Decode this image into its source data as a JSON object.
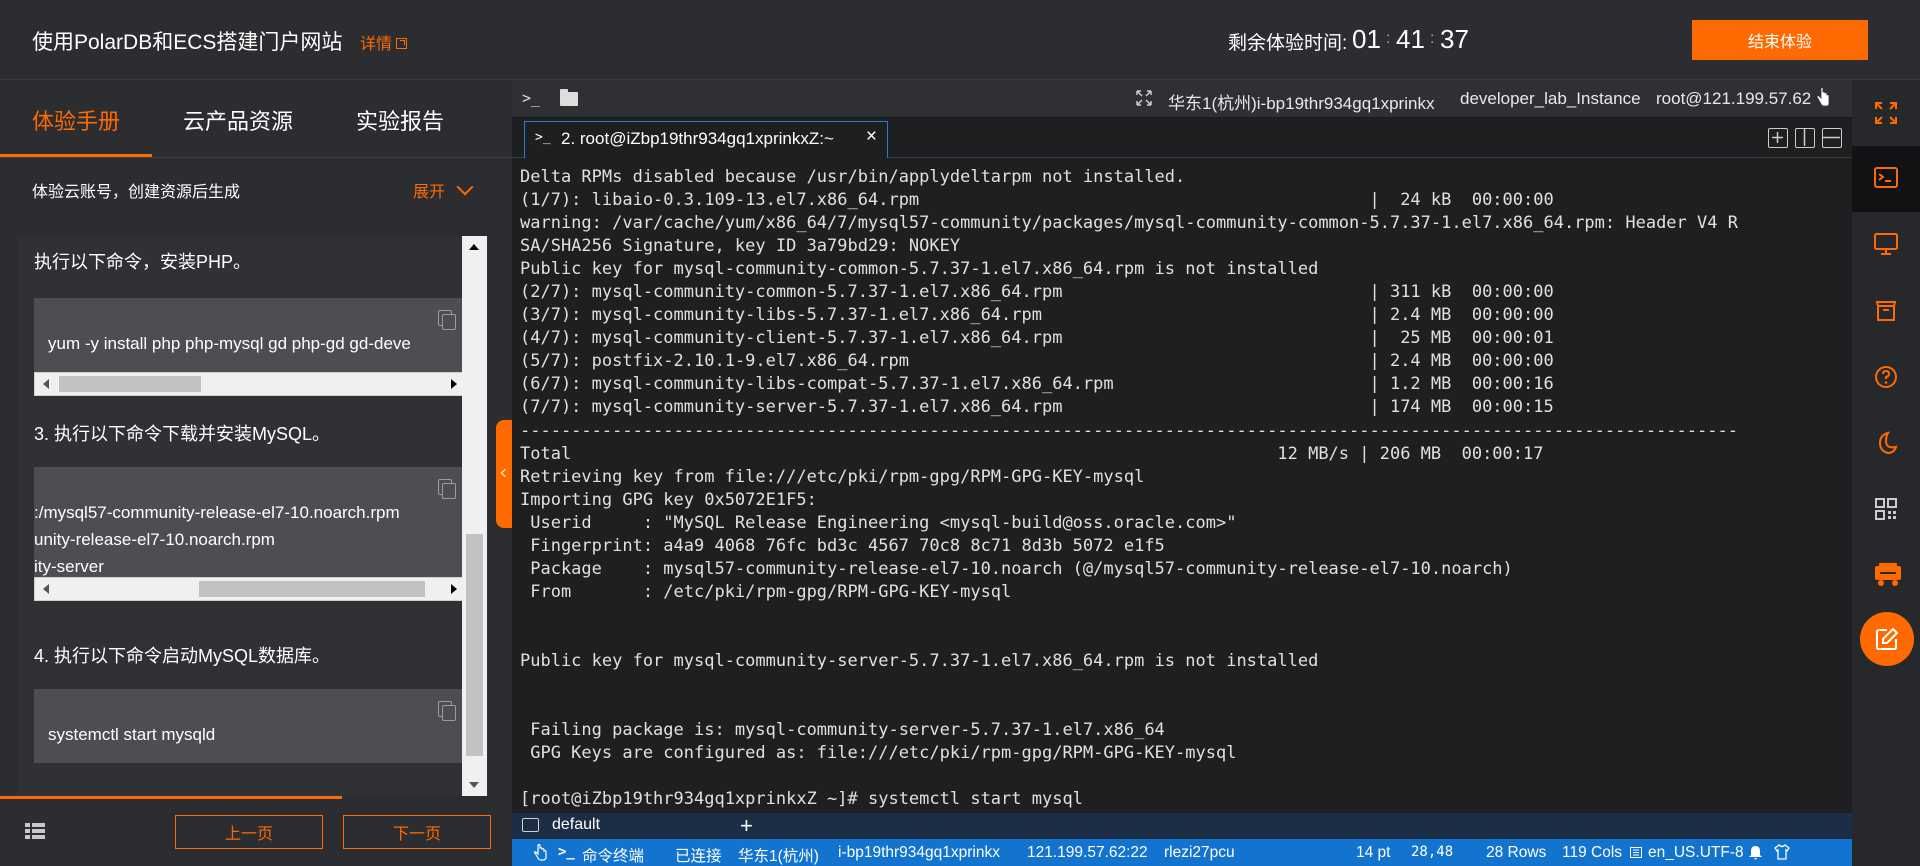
{
  "header": {
    "title": "使用PolarDB和ECS搭建门户网站",
    "details_label": "详情",
    "timer_label": "剩余体验时间:",
    "timer_hours": "01",
    "timer_minutes": "41",
    "timer_seconds": "37",
    "timer_separator": ":",
    "end_button": "结束体验"
  },
  "left_panel": {
    "tabs": [
      {
        "label": "体验手册",
        "active": true
      },
      {
        "label": "云产品资源",
        "active": false
      },
      {
        "label": "实验报告",
        "active": false
      }
    ],
    "account_text": "体验云账号，创建资源后生成",
    "expand_label": "展开",
    "steps": [
      {
        "text": "执行以下命令，安装PHP。",
        "code": [
          "yum -y install php php-mysql gd php-gd gd-deve"
        ]
      },
      {
        "text": "3. 执行以下命令下载并安装MySQL。",
        "code": [
          ":/mysql57-community-release-el7-10.noarch.rpm",
          "unity-release-el7-10.noarch.rpm",
          "ity-server"
        ]
      },
      {
        "text": "4. 执行以下命令启动MySQL数据库。",
        "code": [
          "systemctl start mysqld"
        ]
      }
    ],
    "prev_button": "上一页",
    "next_button": "下一页"
  },
  "terminal": {
    "header_region": "华东1(杭州)i-bp19thr934gq1xprinkx",
    "header_instance": "developer_lab_Instance",
    "header_user": "root@121.199.57.62",
    "tab_label": "2. root@iZbp19thr934gq1xprinkxZ:~",
    "lines": [
      "Delta RPMs disabled because /usr/bin/applydeltarpm not installed.",
      "(1/7): libaio-0.3.109-13.el7.x86_64.rpm                                            |  24 kB  00:00:00",
      "warning: /var/cache/yum/x86_64/7/mysql57-community/packages/mysql-community-common-5.7.37-1.el7.x86_64.rpm: Header V4 R",
      "SA/SHA256 Signature, key ID 3a79bd29: NOKEY",
      "Public key for mysql-community-common-5.7.37-1.el7.x86_64.rpm is not installed",
      "(2/7): mysql-community-common-5.7.37-1.el7.x86_64.rpm                              | 311 kB  00:00:00",
      "(3/7): mysql-community-libs-5.7.37-1.el7.x86_64.rpm                                | 2.4 MB  00:00:00",
      "(4/7): mysql-community-client-5.7.37-1.el7.x86_64.rpm                              |  25 MB  00:00:01",
      "(5/7): postfix-2.10.1-9.el7.x86_64.rpm                                             | 2.4 MB  00:00:00",
      "(6/7): mysql-community-libs-compat-5.7.37-1.el7.x86_64.rpm                         | 1.2 MB  00:00:16",
      "(7/7): mysql-community-server-5.7.37-1.el7.x86_64.rpm                              | 174 MB  00:00:15",
      "-----------------------------------------------------------------------------------------------------------------------",
      "Total                                                                     12 MB/s | 206 MB  00:00:17",
      "Retrieving key from file:///etc/pki/rpm-gpg/RPM-GPG-KEY-mysql",
      "Importing GPG key 0x5072E1F5:",
      " Userid     : \"MySQL Release Engineering <mysql-build@oss.oracle.com>\"",
      " Fingerprint: a4a9 4068 76fc bd3c 4567 70c8 8c71 8d3b 5072 e1f5",
      " Package    : mysql57-community-release-el7-10.noarch (@/mysql57-community-release-el7-10.noarch)",
      " From       : /etc/pki/rpm-gpg/RPM-GPG-KEY-mysql",
      "",
      "",
      "Public key for mysql-community-server-5.7.37-1.el7.x86_64.rpm is not installed",
      "",
      "",
      " Failing package is: mysql-community-server-5.7.37-1.el7.x86_64",
      " GPG Keys are configured as: file:///etc/pki/rpm-gpg/RPM-GPG-KEY-mysql",
      "",
      "[root@iZbp19thr934gq1xprinkxZ ~]# systemctl start mysql"
    ],
    "session_tab": "default",
    "status": {
      "terminal": "命令终端",
      "connected": "已连接",
      "region": "华东1(杭州)",
      "instance": "i-bp19thr934gq1xprinkx",
      "ip": "121.199.57.62:22",
      "user": "rlezi27pcu",
      "font_size": "14 pt",
      "cursor": "28,48",
      "rows": "28 Rows",
      "cols": "119 Cols",
      "encoding": "en_US.UTF-8"
    }
  },
  "right_sidebar": {
    "items": [
      "fullscreen-icon",
      "terminal-icon",
      "desktop-icon",
      "archive-icon",
      "help-icon",
      "theme-icon",
      "qrcode-icon",
      "shopping-cart-icon"
    ],
    "fab_icon": "edit-icon"
  },
  "colors": {
    "accent": "#ff6a00",
    "statusbar": "#1274cf",
    "terminal_bg": "#1e1f21"
  }
}
